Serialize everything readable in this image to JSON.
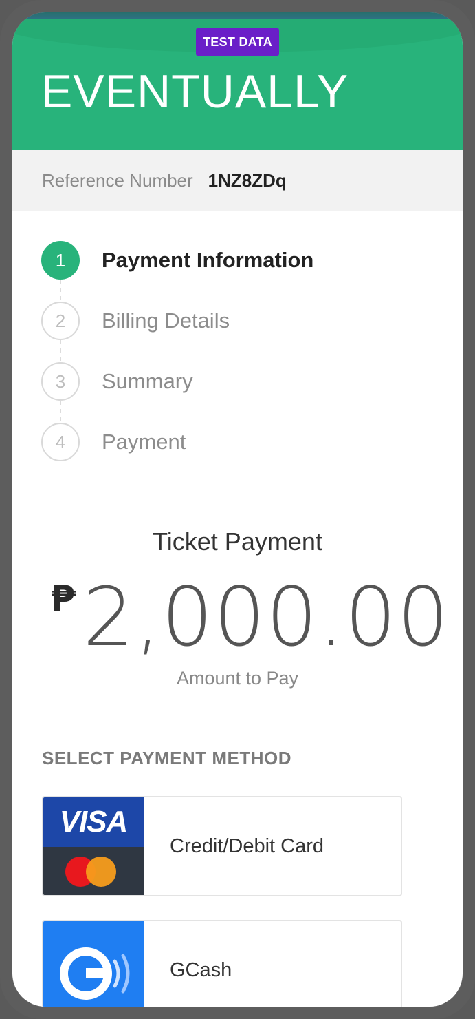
{
  "header": {
    "badge": "TEST DATA",
    "brand": "EVENTUALLY",
    "accent_color": "#28b37b",
    "badge_color": "#6a1fc8"
  },
  "reference": {
    "label": "Reference Number",
    "value": "1NZ8ZDq"
  },
  "steps": [
    {
      "number": "1",
      "label": "Payment Information",
      "active": true
    },
    {
      "number": "2",
      "label": "Billing Details",
      "active": false
    },
    {
      "number": "3",
      "label": "Summary",
      "active": false
    },
    {
      "number": "4",
      "label": "Payment",
      "active": false
    }
  ],
  "payment": {
    "title": "Ticket Payment",
    "currency_symbol": "₱",
    "amount": "2,000.00",
    "amount_label": "Amount to Pay"
  },
  "methods": {
    "section_title": "SELECT PAYMENT METHOD",
    "items": [
      {
        "label": "Credit/Debit Card",
        "logo_text": "VISA",
        "icon": "visa-mastercard-icon"
      },
      {
        "label": "GCash",
        "icon": "gcash-icon"
      }
    ]
  }
}
